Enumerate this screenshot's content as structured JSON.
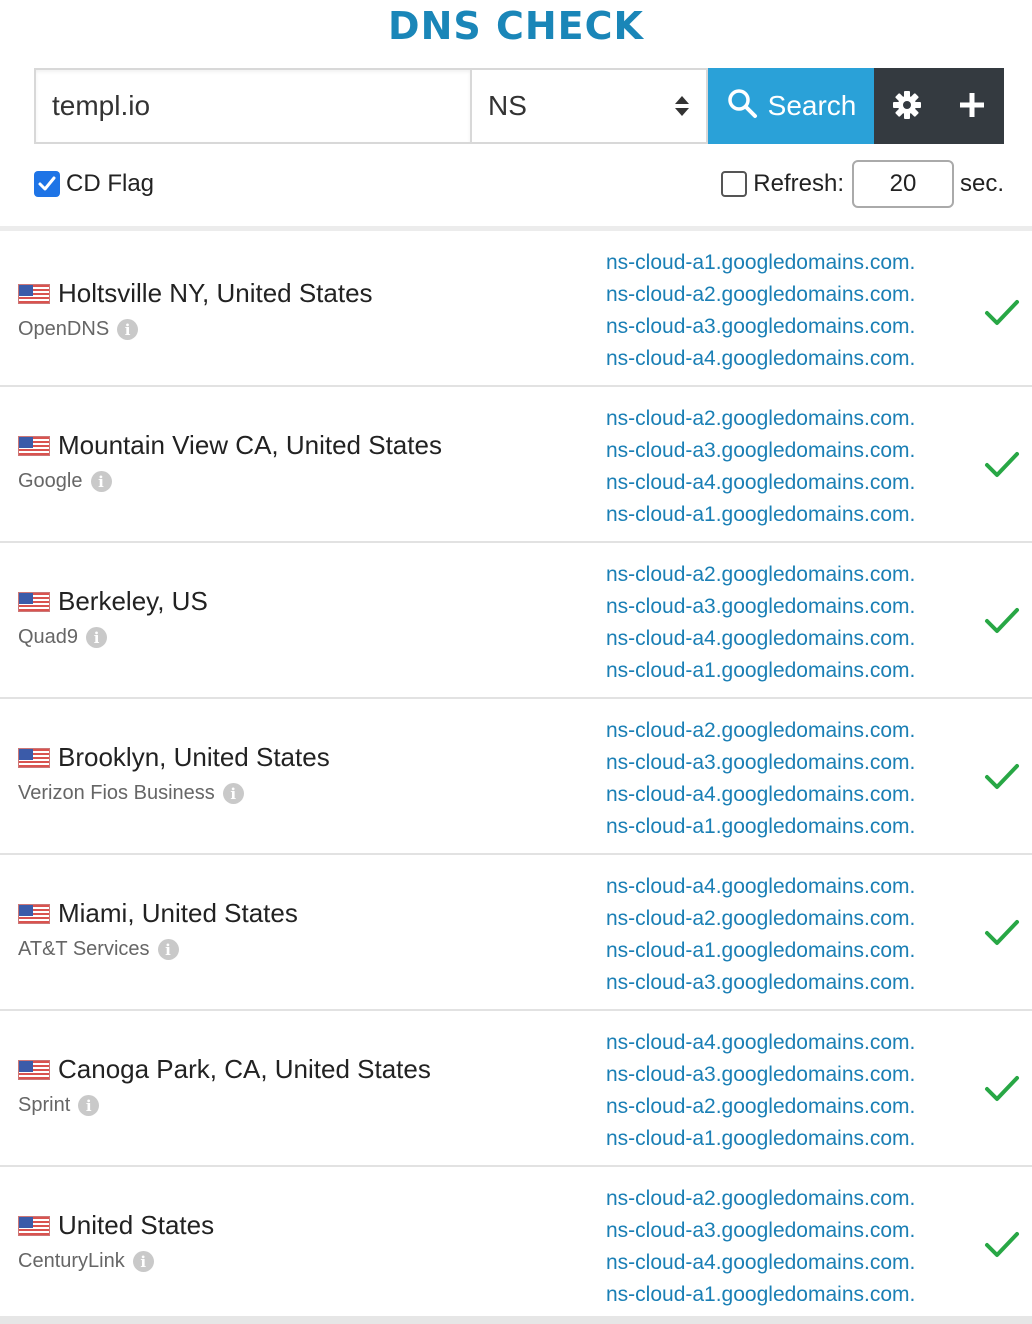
{
  "header": {
    "title": "DNS CHECK"
  },
  "search": {
    "domain_value": "templ.io",
    "record_type": "NS",
    "search_label": "Search"
  },
  "options": {
    "cd_flag_label": "CD Flag",
    "cd_flag_checked": true,
    "refresh_label": "Refresh:",
    "refresh_checked": false,
    "refresh_value": "20",
    "refresh_unit": "sec."
  },
  "results": [
    {
      "location": "Holtsville NY, United States",
      "provider": "OpenDNS",
      "records": [
        "ns-cloud-a1.googledomains.com.",
        "ns-cloud-a2.googledomains.com.",
        "ns-cloud-a3.googledomains.com.",
        "ns-cloud-a4.googledomains.com."
      ]
    },
    {
      "location": "Mountain View CA, United States",
      "provider": "Google",
      "records": [
        "ns-cloud-a2.googledomains.com.",
        "ns-cloud-a3.googledomains.com.",
        "ns-cloud-a4.googledomains.com.",
        "ns-cloud-a1.googledomains.com."
      ]
    },
    {
      "location": "Berkeley, US",
      "provider": "Quad9",
      "records": [
        "ns-cloud-a2.googledomains.com.",
        "ns-cloud-a3.googledomains.com.",
        "ns-cloud-a4.googledomains.com.",
        "ns-cloud-a1.googledomains.com."
      ]
    },
    {
      "location": "Brooklyn, United States",
      "provider": "Verizon Fios Business",
      "records": [
        "ns-cloud-a2.googledomains.com.",
        "ns-cloud-a3.googledomains.com.",
        "ns-cloud-a4.googledomains.com.",
        "ns-cloud-a1.googledomains.com."
      ]
    },
    {
      "location": "Miami, United States",
      "provider": "AT&T Services",
      "records": [
        "ns-cloud-a4.googledomains.com.",
        "ns-cloud-a2.googledomains.com.",
        "ns-cloud-a1.googledomains.com.",
        "ns-cloud-a3.googledomains.com."
      ]
    },
    {
      "location": "Canoga Park, CA, United States",
      "provider": "Sprint",
      "records": [
        "ns-cloud-a4.googledomains.com.",
        "ns-cloud-a3.googledomains.com.",
        "ns-cloud-a2.googledomains.com.",
        "ns-cloud-a1.googledomains.com."
      ]
    },
    {
      "location": "United States",
      "provider": "CenturyLink",
      "records": [
        "ns-cloud-a2.googledomains.com.",
        "ns-cloud-a3.googledomains.com.",
        "ns-cloud-a4.googledomains.com.",
        "ns-cloud-a1.googledomains.com."
      ]
    }
  ],
  "colors": {
    "title": "#1a86b8",
    "search_button": "#2aa1d8",
    "dark_buttons": "#343a40",
    "record_link": "#1a7fb5",
    "success": "#28a745"
  },
  "icons": {
    "search": "search-icon",
    "settings": "gear-icon",
    "add": "plus-icon",
    "status": "checkmark-icon",
    "info": "info-icon",
    "flag": "us-flag-icon"
  }
}
